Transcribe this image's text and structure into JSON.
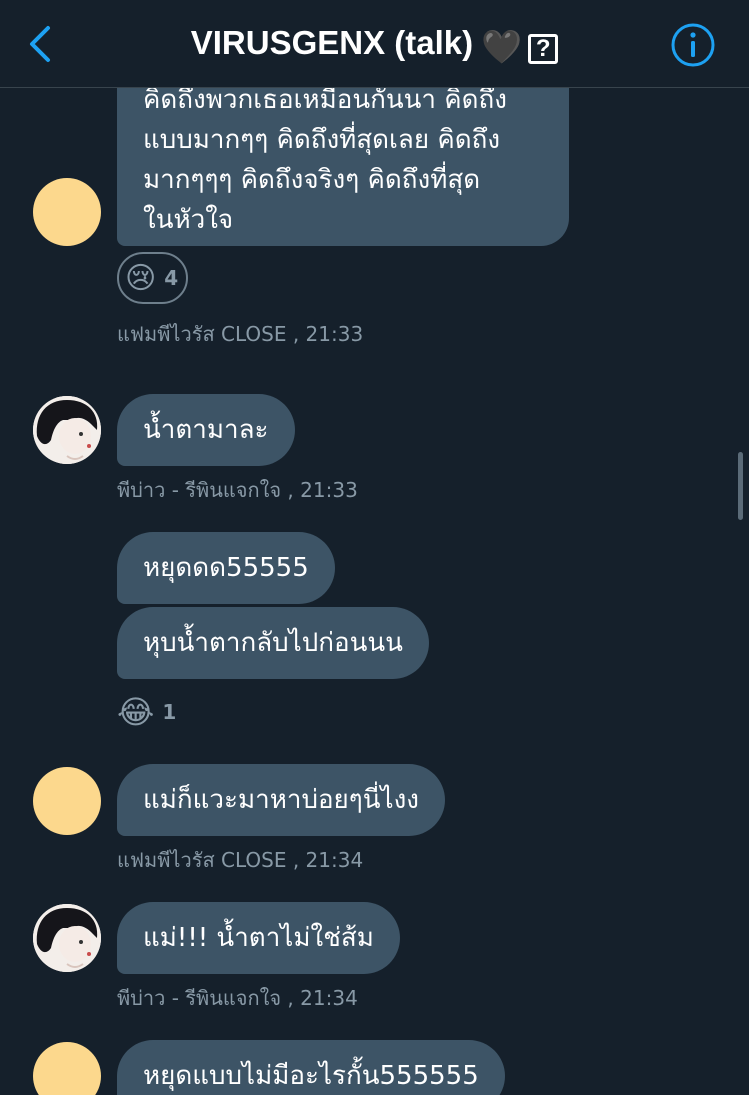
{
  "header": {
    "back_label": "Back",
    "title": "VIRUSGENX (talk)",
    "heart_emoji": "🖤",
    "question_glyph": "?",
    "info_label": "Conversation info",
    "accent_color": "#1da1f2"
  },
  "messages": [
    {
      "lines": [
        "คิดถึงพวกเธอเหมือนกันนา คิดถึง",
        "แบบมากๆๆ คิดถึงที่สุดเลย คิดถึง",
        "มากๆๆๆ คิดถึงจริงๆ คิดถึงที่สุด",
        "ในหัวใจ"
      ],
      "reaction": {
        "emoji": "😢",
        "count": "4"
      },
      "sender": "แฟมพีไวรัส CLOSE",
      "time": " , 21:33"
    },
    {
      "text": "น้ำตามาละ",
      "sender": "พีบ่าว - รีพินแจกใจ",
      "time": " , 21:33"
    },
    {
      "text": "หยุดดด55555"
    },
    {
      "text": "หุบน้ำตากลับไปก่อนนน",
      "reaction": {
        "emoji": "😂",
        "count": "1"
      }
    },
    {
      "text": "แม่ก็แวะมาหาบ่อยๆนี่ไงง",
      "sender": "แฟมพีไวรัส CLOSE",
      "time": " , 21:34"
    },
    {
      "text": "แม่!!! น้ำตาไม่ใช่ส้ม",
      "sender": "พีบ่าว - รีพินแจกใจ",
      "time": " , 21:34"
    },
    {
      "text": "หยุดแบบไม่มีอะไรกั้น555555"
    }
  ]
}
